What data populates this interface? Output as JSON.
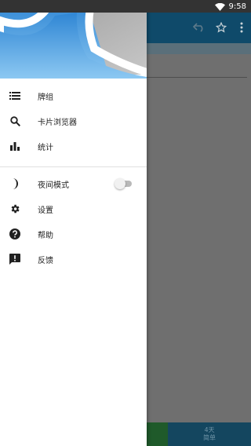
{
  "status_bar": {
    "time": "9:58",
    "wifi_icon": "wifi-icon"
  },
  "toolbar": {
    "icons": [
      "undo-icon",
      "star-outline-icon",
      "overflow-menu-icon"
    ]
  },
  "drawer": {
    "menu_items": [
      {
        "icon": "list-icon",
        "label": "牌组"
      },
      {
        "icon": "search-icon",
        "label": "卡片浏览器"
      },
      {
        "icon": "bar-chart-icon",
        "label": "统计"
      }
    ],
    "secondary_items": [
      {
        "icon": "night-mode-icon",
        "label": "夜间模式",
        "toggle": false
      },
      {
        "icon": "settings-gear-icon",
        "label": "设置"
      },
      {
        "icon": "help-icon",
        "label": "帮助"
      },
      {
        "icon": "feedback-icon",
        "label": "反馈"
      }
    ]
  },
  "bottom_nav": {
    "days": "4天",
    "label": "简单"
  },
  "colors": {
    "toolbar": "#0f4a6a",
    "scrim_content": "#6f6f6f",
    "status_bar": "#333333",
    "header_sky": "#5aa8e4",
    "bottom_green": "#1f5a2a",
    "bottom_blue": "#14465f"
  }
}
